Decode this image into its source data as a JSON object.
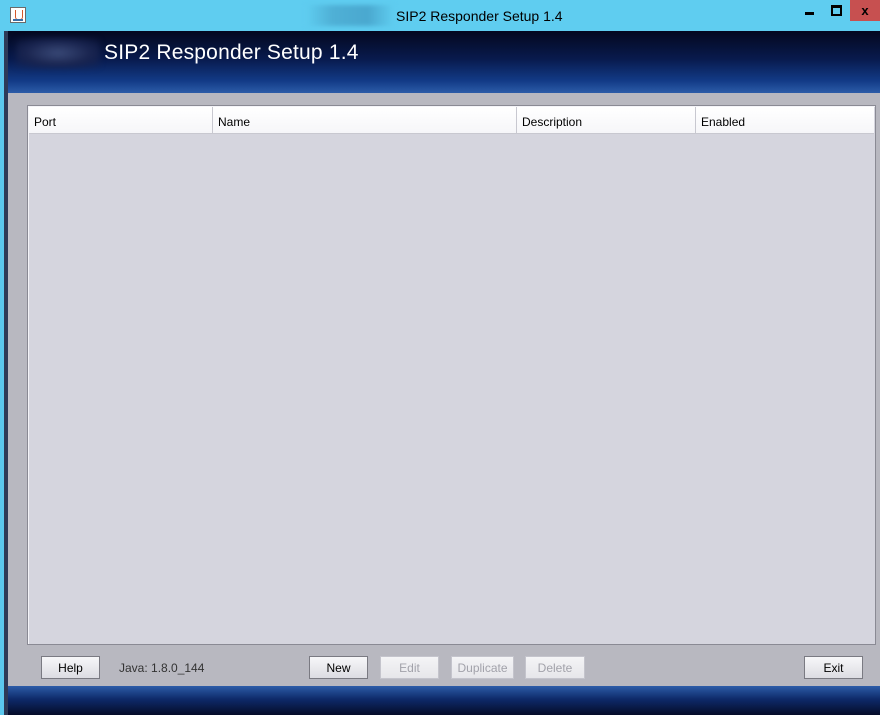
{
  "window": {
    "title": "SIP2 Responder Setup 1.4",
    "controls": {
      "minimize": "minimize",
      "maximize": "maximize",
      "close": "x"
    }
  },
  "header": {
    "app_title": "SIP2 Responder Setup 1.4"
  },
  "table": {
    "columns": [
      "Port",
      "Name",
      "Description",
      "Enabled"
    ],
    "rows": []
  },
  "footer": {
    "help_label": "Help",
    "java_version": "Java: 1.8.0_144",
    "new_label": "New",
    "edit_label": "Edit",
    "duplicate_label": "Duplicate",
    "delete_label": "Delete",
    "exit_label": "Exit"
  },
  "icons": {
    "app": "java-cup-icon",
    "minimize": "minimize-icon",
    "maximize": "maximize-icon",
    "close": "close-icon"
  },
  "colors": {
    "titlebar": "#5fcdf0",
    "header_dark": "#04081f",
    "header_light": "#2c5ca8",
    "panel": "#d5d5de",
    "close_button": "#c75050"
  }
}
